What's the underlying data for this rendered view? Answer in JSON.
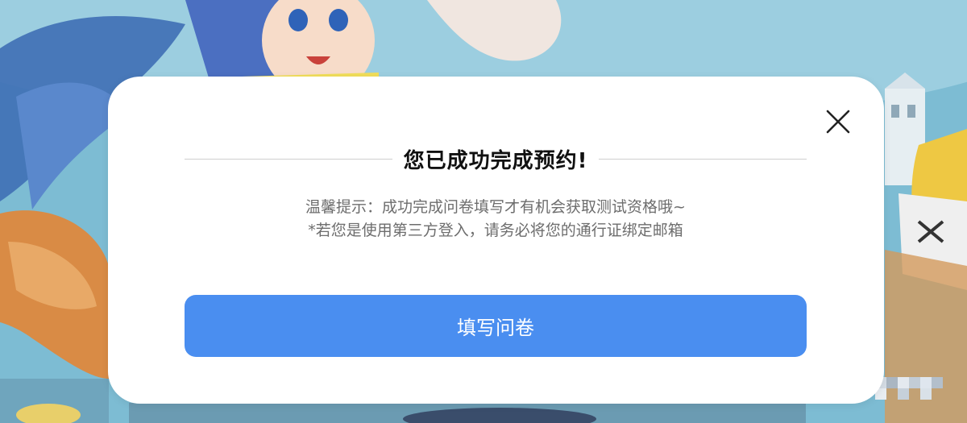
{
  "dialog": {
    "title": "您已成功完成预约!",
    "tip_line1": "温馨提示：成功完成问卷填写才有机会获取测试资格哦~",
    "tip_line2": "*若您是使用第三方登入，请务必将您的通行证绑定邮箱",
    "button_label": "填写问卷",
    "close_icon": "close-icon"
  },
  "colors": {
    "primary": "#4a8ef0",
    "title": "#111111",
    "tip_text": "#6d6d6d",
    "divider": "#cfcfcf",
    "dialog_bg": "#ffffff"
  }
}
